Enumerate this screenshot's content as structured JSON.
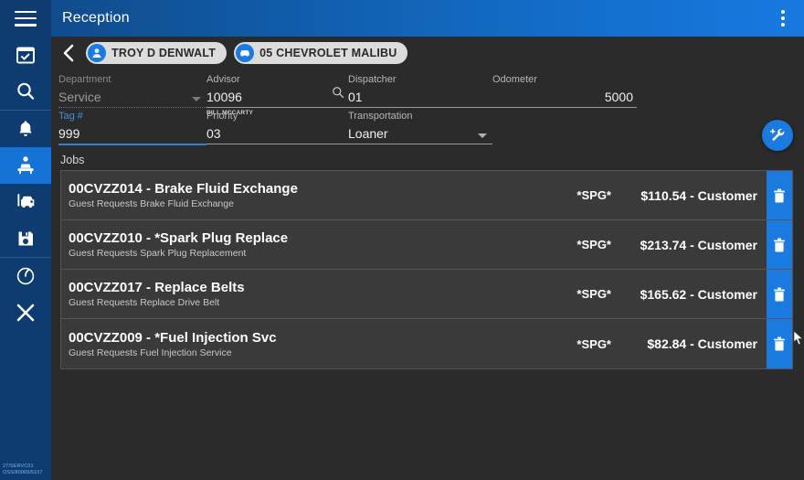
{
  "window": {
    "title": "Reception",
    "menu_icon": "kebab-menu-icon",
    "accent_blue": "#1a7ae0",
    "header_blue_dark": "#0f4c8c",
    "sidebar_blue": "#0d3c73"
  },
  "sidebar": {
    "menu_label": "hamburger-menu-icon",
    "status_code_line1": "27/SERVC01",
    "status_code_line2": "OSS/80069/5107",
    "items": [
      {
        "name": "calendar-check-icon",
        "selected": false
      },
      {
        "name": "search-icon",
        "selected": false
      },
      {
        "name": "bell-icon",
        "selected": false
      },
      {
        "name": "reception-desk-icon",
        "selected": true
      },
      {
        "name": "vehicle-writeup-icon",
        "selected": false
      },
      {
        "name": "save-disk-icon",
        "selected": false
      },
      {
        "name": "gauge-icon",
        "selected": false
      },
      {
        "name": "close-x-icon",
        "selected": false
      }
    ]
  },
  "breadcrumb": {
    "back_label": "back-chevron",
    "customer_chip": "TROY D DENWALT",
    "vehicle_chip": "05 CHEVROLET MALIBU"
  },
  "form": {
    "department": {
      "label": "Department",
      "value": "Service",
      "disabled": true
    },
    "advisor": {
      "label": "Advisor",
      "value": "10096",
      "helper": "BILL MCCARTY"
    },
    "dispatcher": {
      "label": "Dispatcher",
      "value": "01"
    },
    "odometer": {
      "label": "Odometer",
      "value": "5000"
    },
    "tag": {
      "label": "Tag #",
      "value": "999",
      "focused": true
    },
    "priority": {
      "label": "Priority",
      "value": "03"
    },
    "transportation": {
      "label": "Transportation",
      "value": "Loaner"
    }
  },
  "jobs": {
    "section_label": "Jobs",
    "add_job_label": "add-wrench-fab",
    "rows": [
      {
        "title": "00CVZZ014 - Brake Fluid Exchange",
        "subtitle": "Guest Requests Brake Fluid Exchange",
        "code": "*SPG*",
        "price": "$110.54 - Customer",
        "delete_label": "trash-icon"
      },
      {
        "title": "00CVZZ010 - *Spark Plug Replace",
        "subtitle": "Guest Requests Spark Plug Replacement",
        "code": "*SPG*",
        "price": "$213.74 - Customer",
        "delete_label": "trash-icon"
      },
      {
        "title": "00CVZZ017 - Replace Belts",
        "subtitle": "Guest Requests Replace Drive Belt",
        "code": "*SPG*",
        "price": "$165.62 - Customer",
        "delete_label": "trash-icon"
      },
      {
        "title": "00CVZZ009 - *Fuel Injection Svc",
        "subtitle": "Guest Requests Fuel Injection Service",
        "code": "*SPG*",
        "price": "$82.84 - Customer",
        "delete_label": "trash-icon"
      }
    ]
  }
}
